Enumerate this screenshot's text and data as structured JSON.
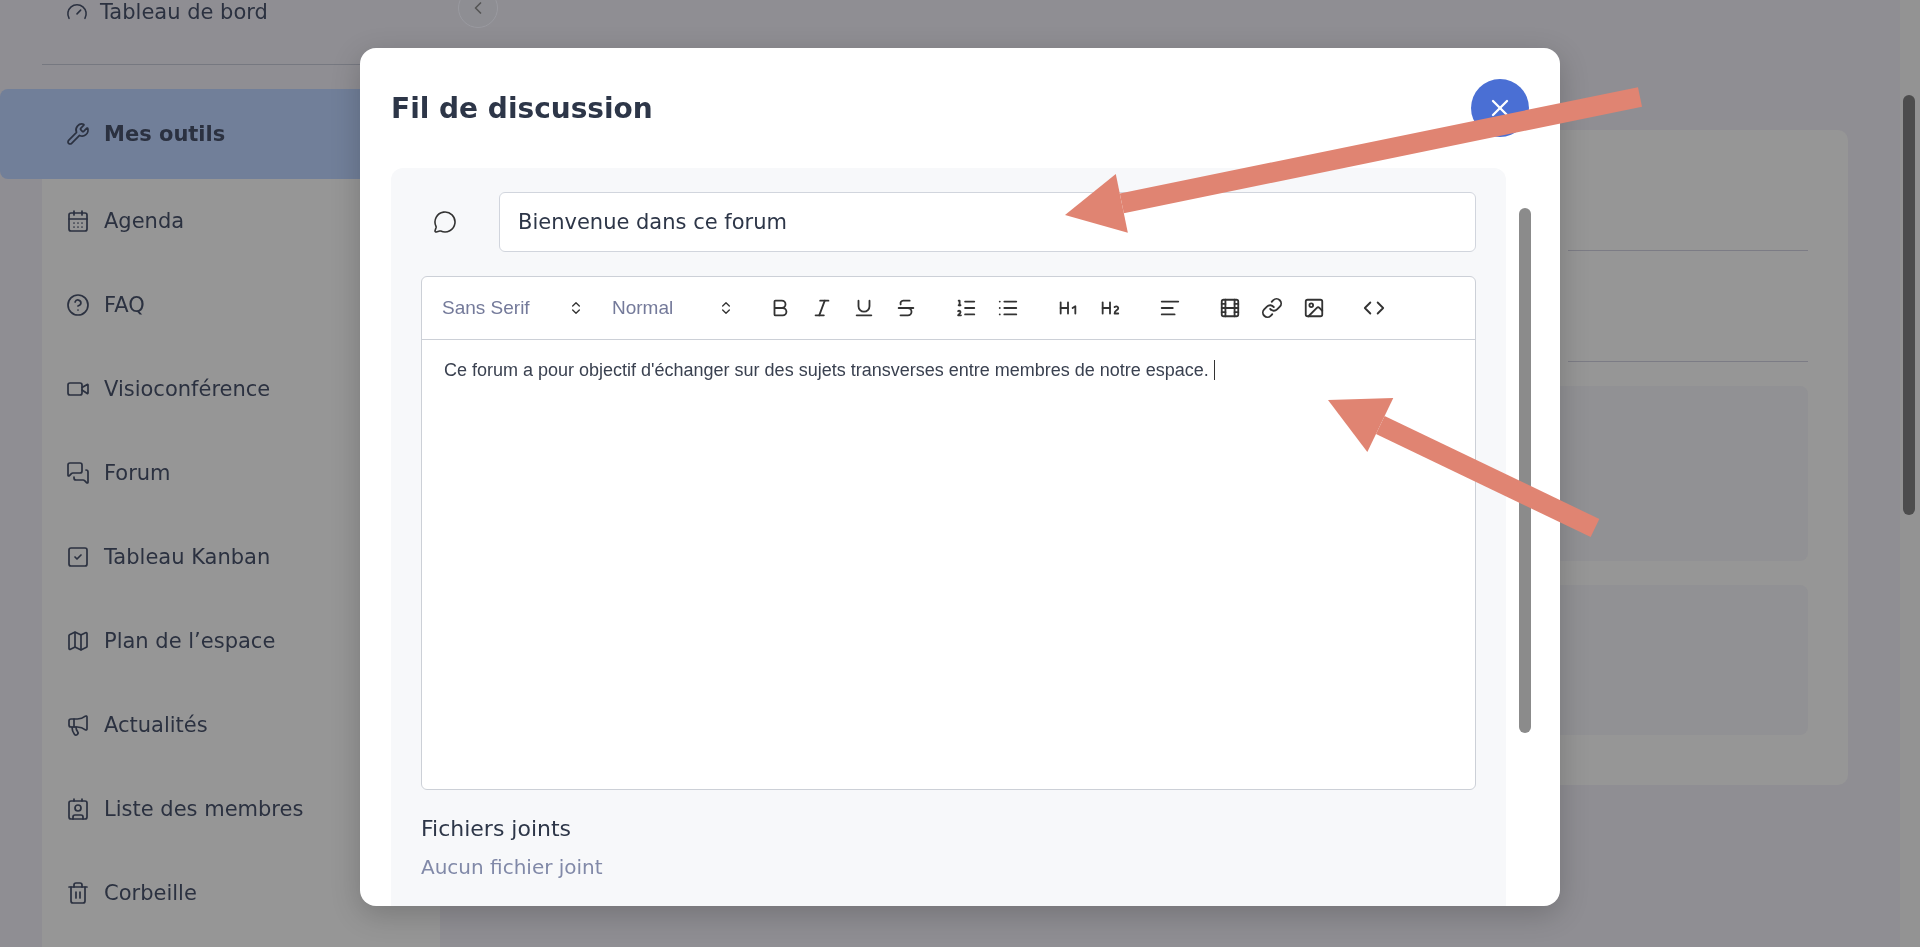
{
  "sidebar": {
    "header": {
      "label": "Tableau de bord",
      "kind": "dashboard"
    },
    "items": [
      {
        "label": "Mes outils",
        "kind": "tools",
        "selected": true
      },
      {
        "label": "Agenda",
        "kind": "calendar",
        "selected": false
      },
      {
        "label": "FAQ",
        "kind": "help",
        "selected": false
      },
      {
        "label": "Visioconférence",
        "kind": "video",
        "selected": false
      },
      {
        "label": "Forum",
        "kind": "forum",
        "selected": false
      },
      {
        "label": "Tableau Kanban",
        "kind": "kanban",
        "selected": false
      },
      {
        "label": "Plan de l’espace",
        "kind": "map",
        "selected": false
      },
      {
        "label": "Actualités",
        "kind": "news",
        "selected": false
      },
      {
        "label": "Liste des membres",
        "kind": "members",
        "selected": false
      },
      {
        "label": "Corbeille",
        "kind": "trash",
        "selected": false
      }
    ]
  },
  "dialog": {
    "title": "Fil de discussion",
    "subject": {
      "value": "Bienvenue dans ce forum"
    },
    "editor": {
      "font": "Sans Serif",
      "size": "Normal",
      "toolbar": [
        {
          "kind": "bold"
        },
        {
          "kind": "italic"
        },
        {
          "kind": "underline"
        },
        {
          "kind": "strike"
        },
        {
          "kind": "ordered-list"
        },
        {
          "kind": "bullet-list"
        },
        {
          "kind": "h1"
        },
        {
          "kind": "h2"
        },
        {
          "kind": "align"
        },
        {
          "kind": "video"
        },
        {
          "kind": "link"
        },
        {
          "kind": "image"
        },
        {
          "kind": "code"
        }
      ],
      "content": "Ce forum a pour objectif d'échanger sur des sujets transverses entre membres de notre espace."
    },
    "attachments": {
      "heading": "Fichiers joints",
      "empty": "Aucun fichier joint"
    }
  }
}
